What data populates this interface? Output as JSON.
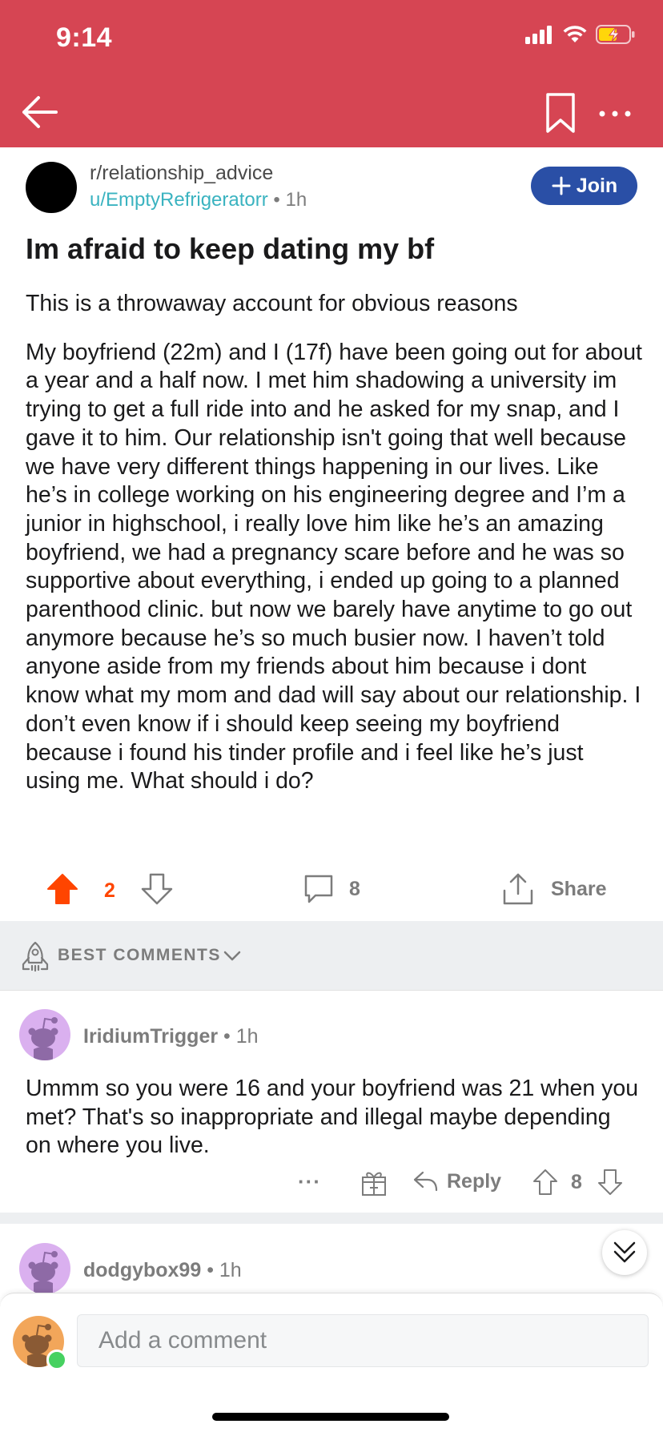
{
  "status_bar": {
    "time": "9:14"
  },
  "colors": {
    "header": "#d64553",
    "join_button": "#2a4fa6",
    "upvote_active": "#ff4500",
    "username_link": "#3ab3c0"
  },
  "post": {
    "subreddit": "r/relationship_advice",
    "author": "u/EmptyRefrigeratorr",
    "separator": "•",
    "age": "1h",
    "join_label": "Join",
    "title": "Im afraid to keep dating my bf",
    "paragraphs": [
      "This is a throwaway account for obvious reasons",
      "My boyfriend (22m) and I (17f) have been going out for about a year and a half now. I met him shadowing a university im trying to get a full ride into and he asked for my snap,  and I gave it to him. Our relationship isn't going that well because we have very different things happening in our lives. Like he’s in college working on his engineering degree and I’m a junior in highschool, i really love him like he’s an amazing boyfriend, we had a pregnancy scare before and he was so supportive about everything, i ended up going to a planned parenthood clinic. but now we barely have anytime to go out anymore because he’s so much busier now. I haven’t told anyone aside from my friends about him because i dont know what my mom and dad will say about our relationship.  I don’t even know if i should keep seeing my boyfriend because i found his tinder profile and i feel like he’s just using me. What should i do?"
    ],
    "vote_count": "2",
    "comment_count": "8",
    "share_label": "Share"
  },
  "sort": {
    "label": "BEST COMMENTS"
  },
  "comments": [
    {
      "user": "IridiumTrigger",
      "age": "1h",
      "body": "Ummm so you were 16 and your boyfriend was 21 when you met? That's so inappropriate and illegal maybe depending on where you live.",
      "more": "···",
      "reply_label": "Reply",
      "votes": "8"
    },
    {
      "user": "dodgybox99",
      "age": "1h"
    }
  ],
  "composer": {
    "placeholder": "Add a comment"
  },
  "icons": [
    "back-arrow-icon",
    "bookmark-icon",
    "more-icon",
    "plus-icon",
    "upvote-icon",
    "downvote-icon",
    "comment-icon",
    "share-icon",
    "rocket-icon",
    "chevron-down-icon",
    "award-icon",
    "reply-icon",
    "double-chevron-down-icon"
  ]
}
